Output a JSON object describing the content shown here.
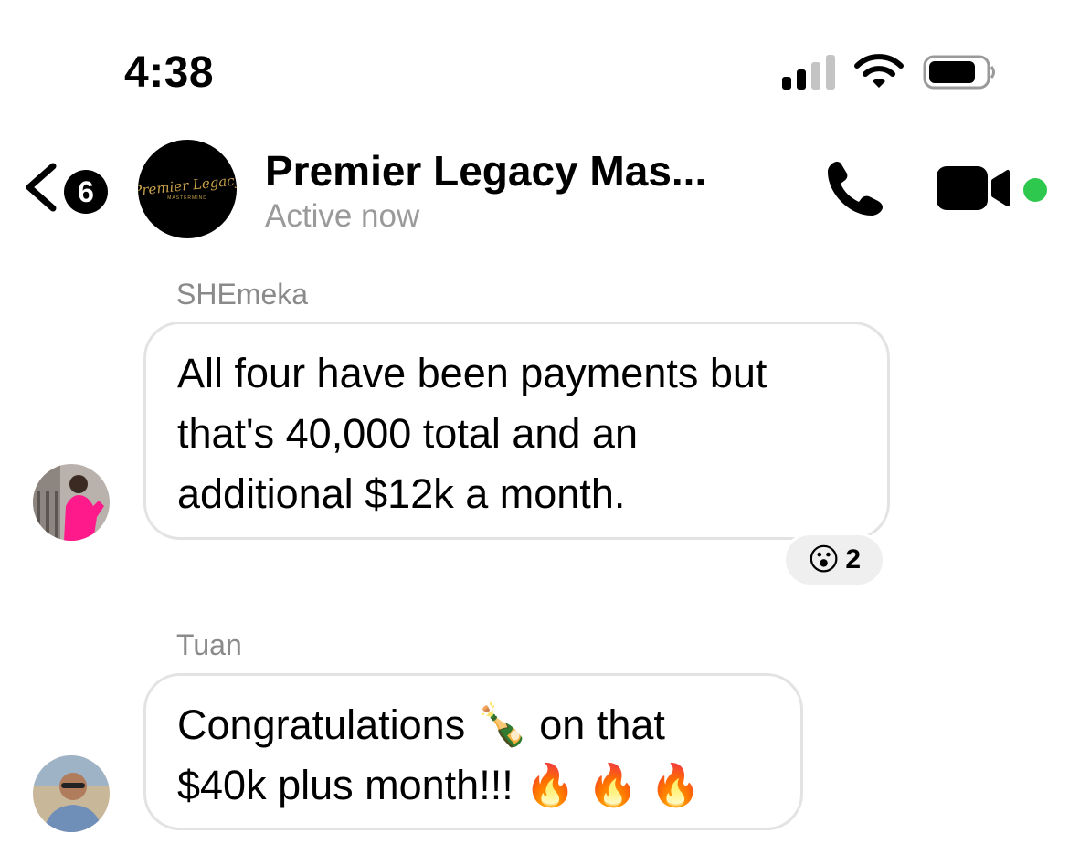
{
  "status_bar": {
    "time": "4:38"
  },
  "header": {
    "unread_count": "6",
    "title": "Premier Legacy Mas...",
    "status": "Active now",
    "avatar_logo_text": "Premier Legacy",
    "avatar_logo_subtext": "MASTERMIND"
  },
  "messages": [
    {
      "sender": "SHEmeka",
      "lines": [
        "All four have been payments but",
        "that's 40,000 total and an",
        "additional $12k a month."
      ],
      "reaction": {
        "emoji": "😮",
        "count": "2"
      }
    },
    {
      "sender": "Tuan",
      "lines": [
        "Congratulations",
        "on that",
        "$40k plus month!!!"
      ],
      "emojis": {
        "champagne": "🍾",
        "fire": "🔥"
      }
    }
  ],
  "colors": {
    "online": "#2dc84d",
    "bubble_border": "#e3e3e3",
    "muted_text": "#9a9a9a"
  }
}
